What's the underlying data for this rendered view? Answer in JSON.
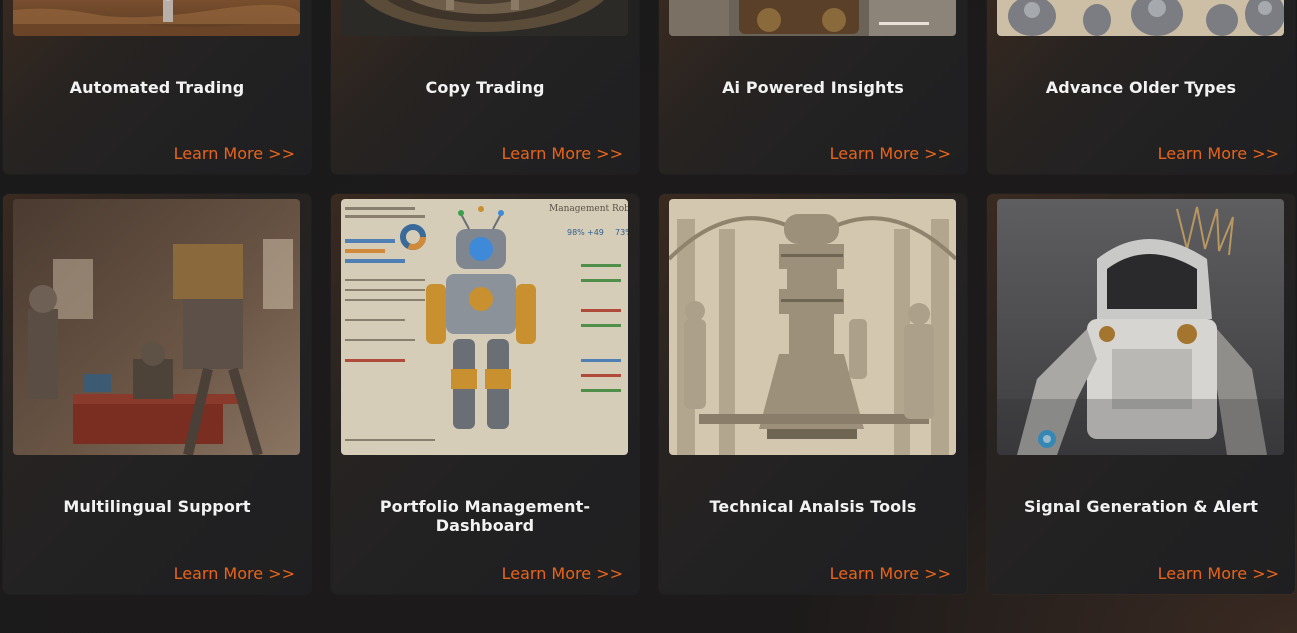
{
  "cards": [
    {
      "title": "Automated Trading",
      "link": "Learn More >>"
    },
    {
      "title": "Copy Trading",
      "link": "Learn More >>"
    },
    {
      "title": "Ai Powered Insights",
      "link": "Learn More >>"
    },
    {
      "title": "Advance Older Types",
      "link": "Learn More >>"
    },
    {
      "title": "Multilingual Support",
      "link": "Learn More >>"
    },
    {
      "title": "Portfolio Management-Dashboard",
      "link": "Learn More >>"
    },
    {
      "title": "Technical Analsis Tools",
      "link": "Learn More >>"
    },
    {
      "title": "Signal Generation & Alert",
      "link": "Learn More >>"
    }
  ],
  "image_text": {
    "portfolio_header": "Management Robotra",
    "stat_1": "98%",
    "stat_2": "+49",
    "stat_3": "73%"
  },
  "colors": {
    "accent": "#e8641b",
    "title": "#f2f2f2",
    "card_bg": "#232122"
  }
}
